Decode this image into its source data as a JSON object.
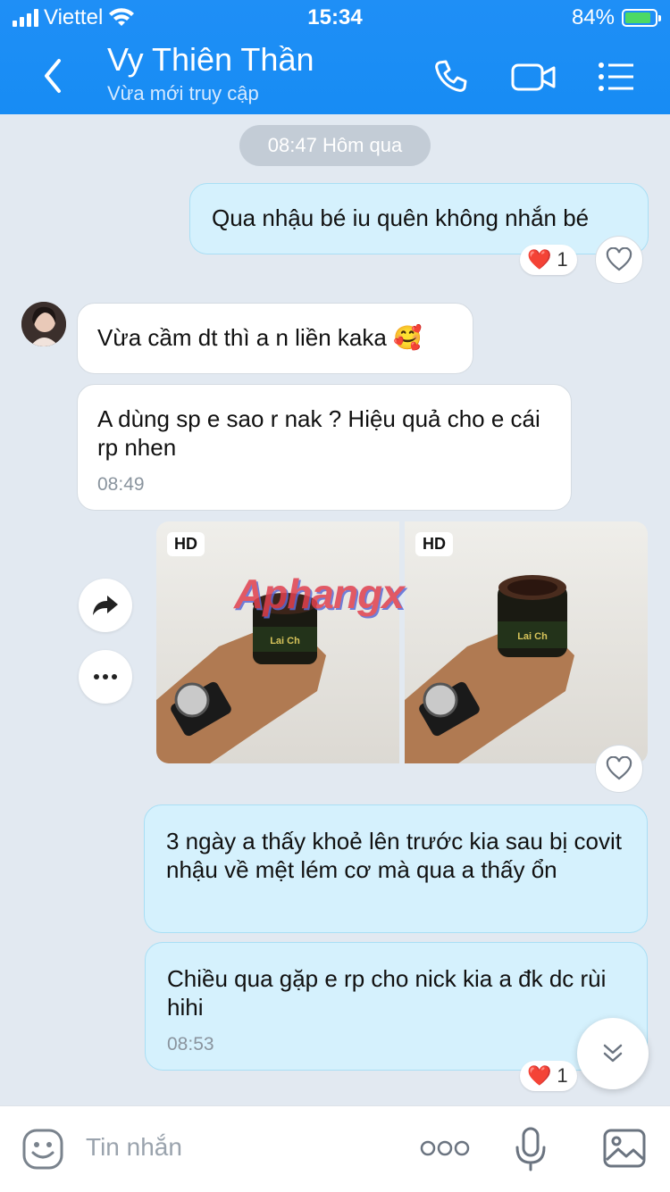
{
  "status_bar": {
    "carrier": "Viettel",
    "time": "15:34",
    "battery": "84%"
  },
  "header": {
    "contact_name": "Vy Thiên Thần",
    "presence": "Vừa mới truy cập"
  },
  "icons": [
    "back-arrow-icon",
    "phone-icon",
    "video-call-icon",
    "menu-icon",
    "heart-icon",
    "share-icon",
    "more-icon",
    "double-chevron-down-icon",
    "emoji-icon",
    "ellipsis-icon",
    "microphone-icon",
    "image-icon"
  ],
  "chat": {
    "date_separator": "08:47 Hôm qua",
    "messages": [
      {
        "dir": "out",
        "text": "Qua nhậu bé iu quên không nhắn bé",
        "reaction": {
          "emoji": "❤️",
          "count": "1"
        }
      },
      {
        "dir": "in",
        "text": "Vừa cầm dt thì a n liền kaka 🥰"
      },
      {
        "dir": "in",
        "text": "A dùng sp e sao r nak ? Hiệu quả cho e cái rp nhen",
        "time": "08:49"
      },
      {
        "dir": "in",
        "type": "photos",
        "badges": [
          "HD",
          "HD"
        ]
      },
      {
        "dir": "out",
        "text": "3 ngày a thấy khoẻ lên trước kia sau bị covit nhậu về mệt lém cơ mà qua a thấy ổn"
      },
      {
        "dir": "out",
        "text": "Chiều qua gặp e rp cho nick kia a đk dc rùi hihi",
        "time": "08:53",
        "reaction": {
          "emoji": "❤️",
          "count": "1"
        }
      }
    ],
    "watermark": "Aphangx"
  },
  "input": {
    "placeholder": "Tin nhắn"
  },
  "colors": {
    "header": "#1f8ff6",
    "outgoing_bubble": "#d5f1fd",
    "incoming_bubble": "#ffffff",
    "chat_bg": "#e2e9f1"
  }
}
